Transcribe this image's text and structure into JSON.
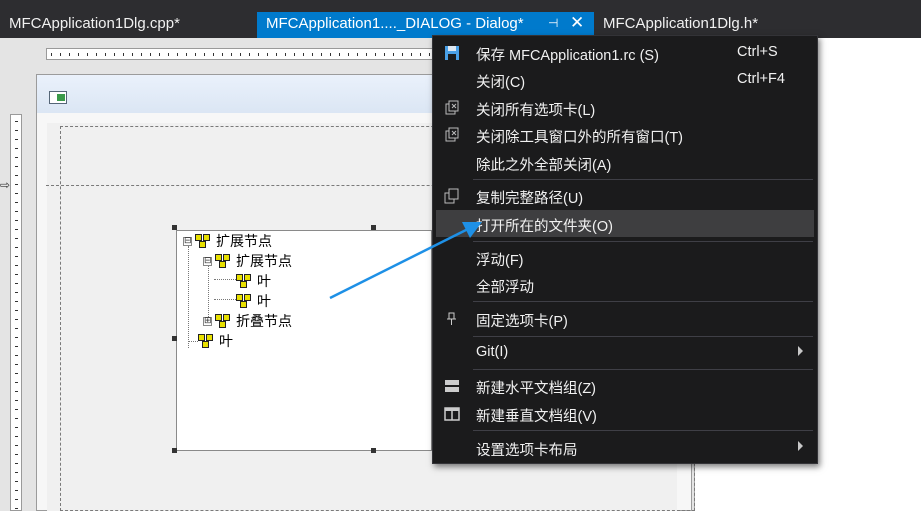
{
  "tabs": [
    {
      "label": "MFCApplication1Dlg.cpp*",
      "active": false
    },
    {
      "label": "MFCApplication1...._DIALOG - Dialog*",
      "active": true,
      "pin_icon": "pin-icon",
      "close_icon": "close-icon"
    },
    {
      "label": "MFCApplication1Dlg.h*",
      "active": false
    }
  ],
  "tree": {
    "nodes": [
      {
        "label": "扩展节点",
        "expander": "⊟"
      },
      {
        "label": "扩展节点",
        "expander": "⊟"
      },
      {
        "label": "叶"
      },
      {
        "label": "叶"
      },
      {
        "label": "折叠节点",
        "expander": "⊞"
      },
      {
        "label": "叶"
      }
    ]
  },
  "context_menu": {
    "items": [
      {
        "label": "保存 MFCApplication1.rc (S)",
        "shortcut": "Ctrl+S",
        "icon": "save-icon"
      },
      {
        "label": "关闭(C)",
        "shortcut": "Ctrl+F4"
      },
      {
        "label": "关闭所有选项卡(L)",
        "icon": "close-tabs-icon"
      },
      {
        "label": "关闭除工具窗口外的所有窗口(T)",
        "icon": "close-windows-icon"
      },
      {
        "label": "除此之外全部关闭(A)"
      },
      {
        "label": "复制完整路径(U)",
        "icon": "copy-path-icon"
      },
      {
        "label": "打开所在的文件夹(O)",
        "highlighted": true
      },
      {
        "label": "浮动(F)"
      },
      {
        "label": "全部浮动"
      },
      {
        "label": "固定选项卡(P)",
        "icon": "pin-icon"
      },
      {
        "label": "Git(I)",
        "submenu": true
      },
      {
        "label": "新建水平文档组(Z)",
        "icon": "horizontal-group-icon"
      },
      {
        "label": "新建垂直文档组(V)",
        "icon": "vertical-group-icon"
      },
      {
        "label": "设置选项卡布局",
        "submenu": true
      }
    ]
  },
  "colors": {
    "tab_strip": "#2d2d30",
    "active_tab": "#007acc",
    "menu_bg": "#1b1b1c",
    "menu_highlight": "#3e3e40",
    "menu_text": "#f1f1f1",
    "callout_arrow": "#1e90e6"
  }
}
